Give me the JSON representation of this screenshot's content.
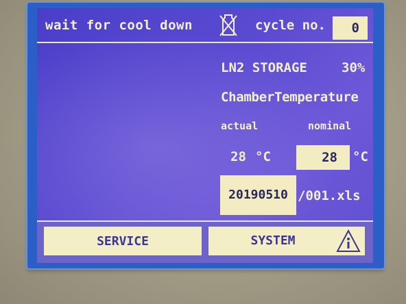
{
  "header": {
    "status": "wait for cool down",
    "cycle_label": "cycle no.",
    "cycle_value": "0",
    "status_icon": "no-cooling-icon"
  },
  "storage": {
    "label": "LN2 STORAGE",
    "value": "30%"
  },
  "chamber": {
    "title": "ChamberTemperature",
    "actual_label": "actual",
    "nominal_label": "nominal",
    "actual_value": "28",
    "actual_unit": "°C",
    "nominal_value": "28",
    "nominal_unit": "°C"
  },
  "file": {
    "name": "20190510",
    "suffix": "/001.xls"
  },
  "buttons": {
    "service": "SERVICE",
    "system": "SYSTEM",
    "info_icon": "info-warning-icon"
  },
  "colors": {
    "screen": "#5a4ad1",
    "text": "#f4f0c8",
    "field": "#f3ecc2",
    "frame": "#2b5fc7"
  }
}
